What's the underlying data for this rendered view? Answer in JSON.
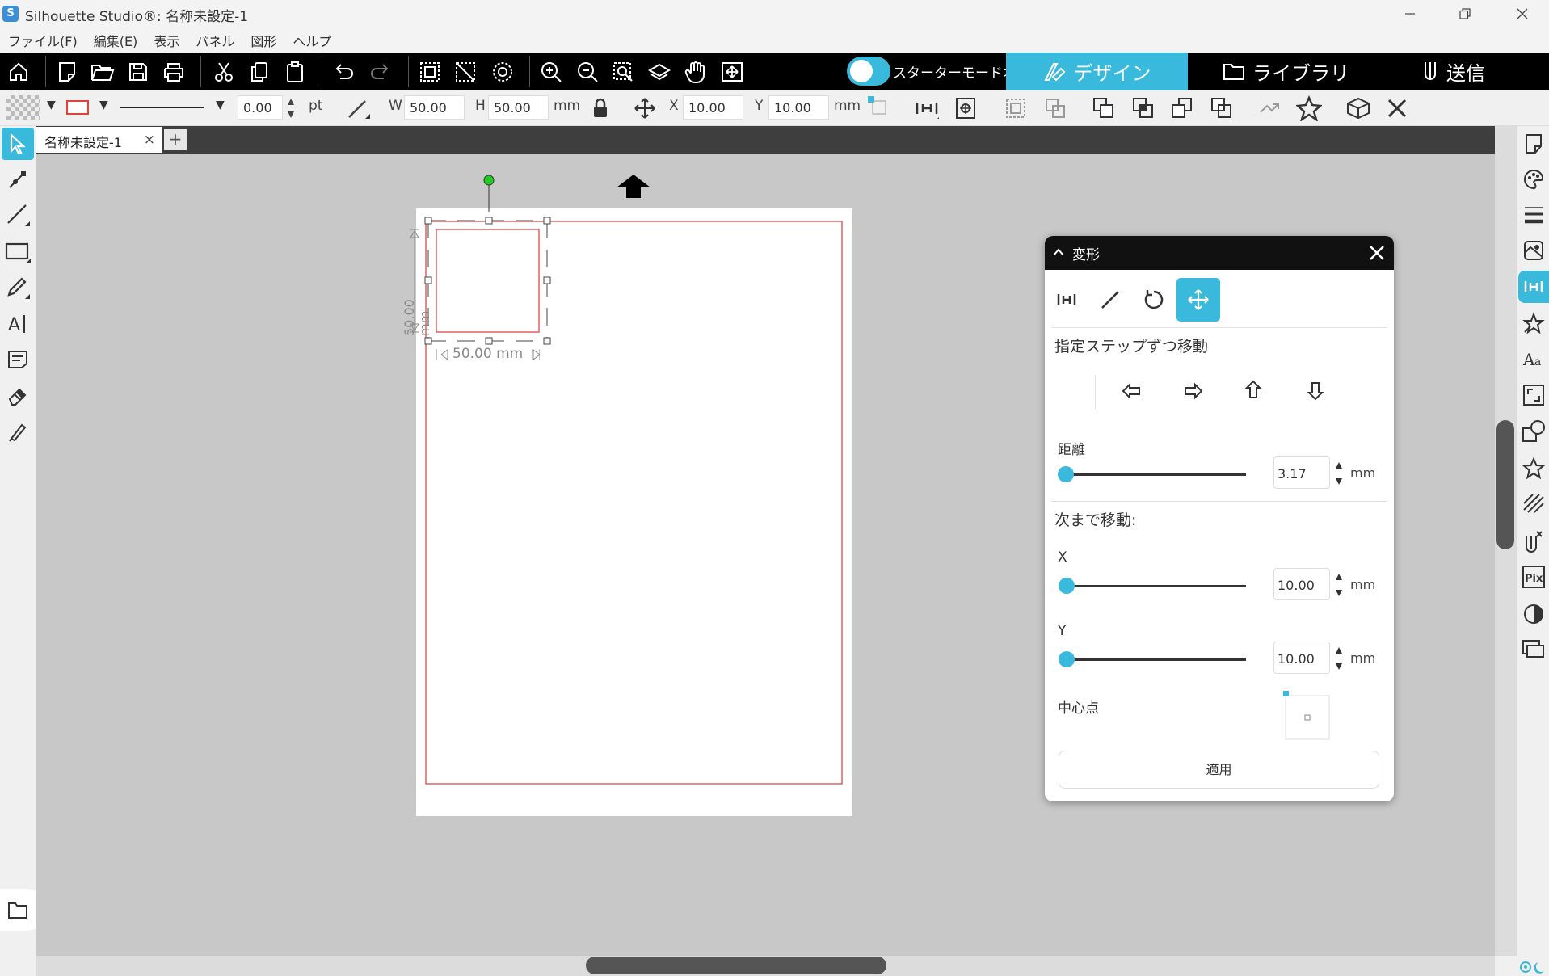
{
  "window": {
    "app_logo": "S",
    "title": "Silhouette Studio®: 名称未設定-1"
  },
  "menu": [
    "ファイル(F)",
    "編集(E)",
    "表示",
    "パネル",
    "図形",
    "ヘルプ"
  ],
  "toolbar": {
    "starter_mode_label": "スターターモードオフ",
    "starter_mode_on": false,
    "tabs": {
      "design": "デザイン",
      "library": "ライブラリ",
      "send": "送信"
    }
  },
  "properties": {
    "stroke_width": "0.00",
    "stroke_unit": "pt",
    "w_label": "W",
    "w_value": "50.00",
    "h_label": "H",
    "h_value": "50.00",
    "size_unit": "mm",
    "x_label": "X",
    "x_value": "10.00",
    "y_label": "Y",
    "y_value": "10.00",
    "pos_unit": "mm"
  },
  "document": {
    "tab_label": "名称未設定-1",
    "tab_close": "×",
    "add_tab": "+",
    "width_dimension": "50.00 mm",
    "height_dimension": "50.00 mm"
  },
  "transform_panel": {
    "title": "変形",
    "step_move_label": "指定ステップずつ移動",
    "distance_label": "距離",
    "distance_value": "3.17",
    "distance_unit": "mm",
    "move_to_label": "次まで移動:",
    "x_label": "X",
    "x_value": "10.00",
    "x_unit": "mm",
    "y_label": "Y",
    "y_value": "10.00",
    "y_unit": "mm",
    "center_label": "中心点",
    "apply_label": "適用"
  },
  "colors": {
    "accent": "#39b9dc",
    "toolbar_bg": "#000000",
    "canvas_bg": "#c8c8c8",
    "cut_border": "#e06060",
    "rotate_handle": "#22cc22"
  }
}
